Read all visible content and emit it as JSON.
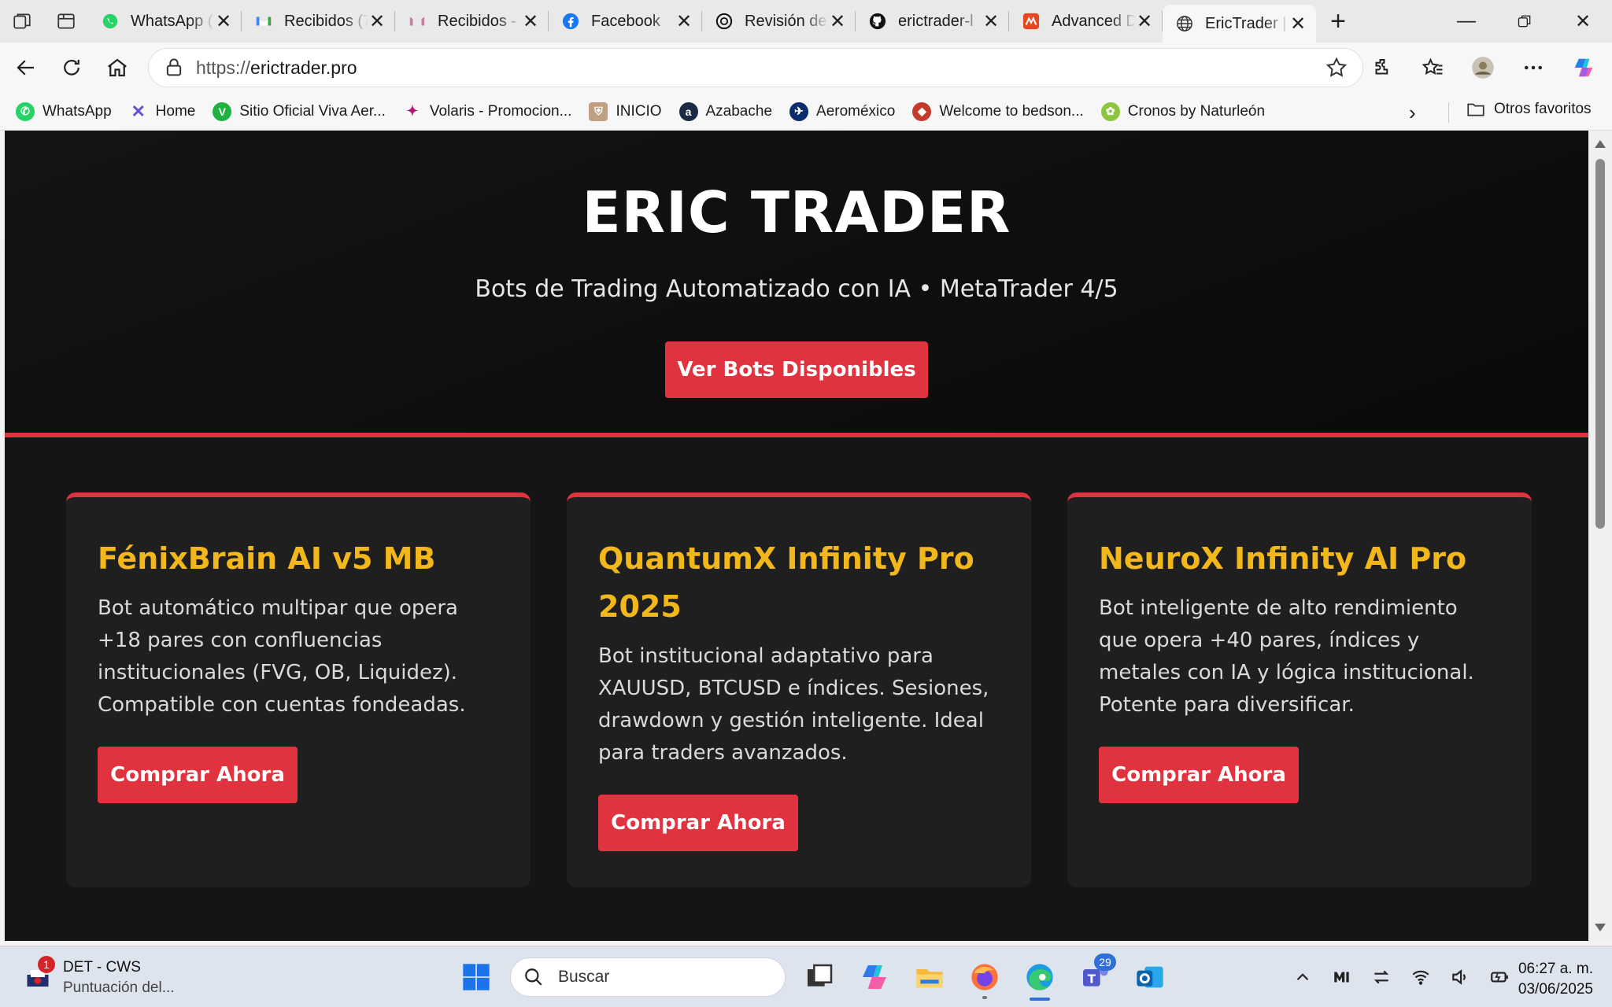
{
  "browser": {
    "tabs": [
      {
        "title": "WhatsApp (",
        "favicon": "whatsapp-icon",
        "active": false
      },
      {
        "title": "Recibidos (7",
        "favicon": "gmail-icon",
        "active": false
      },
      {
        "title": "Recibidos -",
        "favicon": "gmail-icon",
        "active": false
      },
      {
        "title": "Facebook",
        "favicon": "facebook-icon",
        "active": false
      },
      {
        "title": "Revisión de",
        "favicon": "openai-icon",
        "active": false
      },
      {
        "title": "erictrader-l",
        "favicon": "github-icon",
        "active": false
      },
      {
        "title": "Advanced D",
        "favicon": "app-icon",
        "active": false
      },
      {
        "title": "EricTrader |",
        "favicon": "globe-icon",
        "active": true
      }
    ],
    "url_protocol": "https://",
    "url_host": "erictrader.pro",
    "bookmarks": [
      {
        "label": "WhatsApp",
        "icon": "whatsapp-icon",
        "color": "#25d366"
      },
      {
        "label": "Home",
        "icon": "x-logo-icon",
        "color": "#6b4fd8"
      },
      {
        "label": "Sitio Oficial Viva Aer...",
        "icon": "viva-icon",
        "color": "#1fb141"
      },
      {
        "label": "Volaris - Promocion...",
        "icon": "volaris-icon",
        "color": "#b0187a"
      },
      {
        "label": "INICIO",
        "icon": "shield-icon",
        "color": "#c0a080"
      },
      {
        "label": "Azabache",
        "icon": "azabache-icon",
        "color": "#1b2a44"
      },
      {
        "label": "Aeroméxico",
        "icon": "aeromexico-icon",
        "color": "#0b2d6b"
      },
      {
        "label": "Welcome to bedson...",
        "icon": "bedson-icon",
        "color": "#c23b2b"
      },
      {
        "label": "Cronos by Naturleón",
        "icon": "cronos-icon",
        "color": "#8cc63f"
      }
    ],
    "other_favorites": "Otros favoritos"
  },
  "site": {
    "title": "ERIC TRADER",
    "subtitle": "Bots de Trading Automatizado con IA • MetaTrader 4/5",
    "cta": "Ver Bots Disponibles",
    "accent_color": "#e0323f",
    "product_title_color": "#f2b81b",
    "products": [
      {
        "name": "FénixBrain AI v5 MB",
        "description": "Bot automático multipar que opera +18 pares con confluencias institucionales (FVG, OB, Liquidez). Compatible con cuentas fondeadas.",
        "button": "Comprar Ahora"
      },
      {
        "name": "QuantumX Infinity Pro 2025",
        "description": "Bot institucional adaptativo para XAUUSD, BTCUSD e índices. Sesiones, drawdown y gestión inteligente. Ideal para traders avanzados.",
        "button": "Comprar Ahora"
      },
      {
        "name": "NeuroX Infinity AI Pro",
        "description": "Bot inteligente de alto rendimiento que opera +40 pares, índices y metales con IA y lógica institucional. Potente para diversificar.",
        "button": "Comprar Ahora"
      }
    ]
  },
  "taskbar": {
    "notification_badge": "1",
    "notification_title": "DET - CWS",
    "notification_text": "Puntuación del...",
    "search_placeholder": "Buscar",
    "teams_badge": "29",
    "time": "06:27 a. m.",
    "date": "03/06/2025"
  }
}
